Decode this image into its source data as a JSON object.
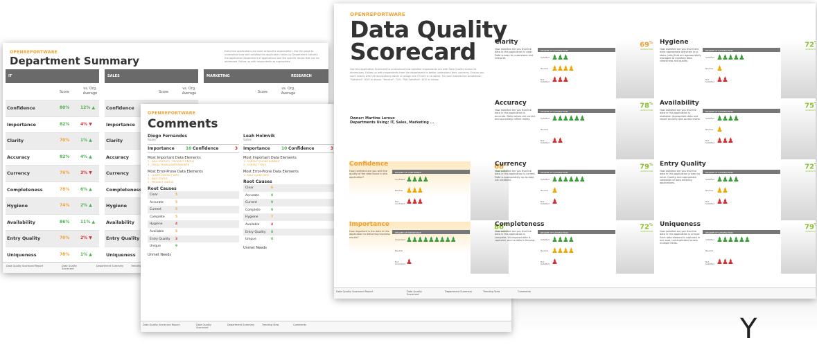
{
  "brand": "OPENREPORTWARE",
  "page1": {
    "title": "Department Summary",
    "description": "Executive applications are used across the organization. Use this page to understand how well satisfied the application varies by Department. Identify the application department of applications and the specific issues that can be addressed. Follow up with respondents as appropriate.",
    "columns": [
      {
        "name": "IT",
        "score_label": "Score",
        "vs_label": "vs. Org. Average",
        "rows": [
          {
            "label": "Confidence",
            "score": "80%",
            "score_color": "green",
            "delta": "12%",
            "dir": "up"
          },
          {
            "label": "Importance",
            "score": "82%",
            "score_color": "green",
            "delta": "4%",
            "dir": "down"
          },
          {
            "label": "Clarity",
            "score": "70%",
            "score_color": "orange",
            "delta": "1%",
            "dir": "up"
          },
          {
            "label": "Accuracy",
            "score": "82%",
            "score_color": "green",
            "delta": "4%",
            "dir": "up"
          },
          {
            "label": "Currency",
            "score": "76%",
            "score_color": "orange",
            "delta": "3%",
            "dir": "down"
          },
          {
            "label": "Completeness",
            "score": "78%",
            "score_color": "orange",
            "delta": "6%",
            "dir": "up"
          },
          {
            "label": "Hygiene",
            "score": "74%",
            "score_color": "orange",
            "delta": "2%",
            "dir": "up"
          },
          {
            "label": "Availability",
            "score": "86%",
            "score_color": "green",
            "delta": "11%",
            "dir": "up"
          },
          {
            "label": "Entry Quality",
            "score": "70%",
            "score_color": "orange",
            "delta": "2%",
            "dir": "down"
          },
          {
            "label": "Uniqueness",
            "score": "78%",
            "score_color": "orange",
            "delta": "1%",
            "dir": "up"
          }
        ]
      },
      {
        "name": "SALES",
        "score_label": "Score",
        "vs_label": "vs. Org. Average",
        "rows": [
          {
            "label": "Confidence"
          },
          {
            "label": "Importance"
          },
          {
            "label": "Clarity"
          },
          {
            "label": "Accuracy"
          },
          {
            "label": "Currency"
          },
          {
            "label": "Completeness"
          },
          {
            "label": "Hygiene"
          },
          {
            "label": "Availability"
          },
          {
            "label": "Entry Quality"
          },
          {
            "label": "Uniqueness"
          }
        ]
      },
      {
        "name": "MARKETING",
        "score_label": "Score",
        "vs_label": "vs. Org. Average",
        "rows": []
      },
      {
        "name": "RESEARCH",
        "rows": []
      }
    ],
    "footer_tabs": [
      "Data Quality Scorecard Report",
      "Data Quality Scorecard",
      "Department Summary",
      "Trending View"
    ]
  },
  "page2": {
    "title": "Comments",
    "people": [
      {
        "name": "Diego Fernandes",
        "dept": "Sales",
        "importance_label": "Importance",
        "importance": "10",
        "confidence_label": "Confidence",
        "confidence": "3",
        "important_heading": "Most Important Data Elements",
        "important_items": [
          "1 - SALE STATUS  2 - PRODUCT STATUS",
          "3 - FISCAL YEAR/QUARTER/MONTH"
        ],
        "error_heading": "Most Error-Prone Data Elements",
        "error_items": [
          "1 - CLIENT CONTACT INFO",
          "2 - SALE STATUS",
          "3 - PRODUCT STATUS"
        ],
        "root_heading": "Root Causes",
        "root_causes": [
          {
            "name": "Clear",
            "value": "5"
          },
          {
            "name": "Accurate",
            "value": "5"
          },
          {
            "name": "Current",
            "value": "5"
          },
          {
            "name": "Complete",
            "value": "5"
          },
          {
            "name": "Hygiene",
            "value": "4"
          },
          {
            "name": "Available",
            "value": "5"
          },
          {
            "name": "Entry Quality",
            "value": "3"
          },
          {
            "name": "Unique",
            "value": "9"
          }
        ],
        "unmet_heading": "Unmet Needs"
      },
      {
        "name": "Leah Holmvik",
        "dept": "Sales",
        "importance_label": "Importance",
        "importance": "10",
        "confidence_label": "Confidence",
        "confidence": "3",
        "important_heading": "Most Important Data Elements",
        "important_items": [
          "1 - CONTACT PHONE NUMBER",
          "2 - CONTACT TITLE"
        ],
        "error_heading": "Most Error-Prone Data Elements",
        "error_items": [
          "1 - SALE CLOSE DATE"
        ],
        "root_heading": "Root Causes",
        "root_causes": [
          {
            "name": "Clear",
            "value": "6"
          },
          {
            "name": "Accurate",
            "value": "8"
          },
          {
            "name": "Current",
            "value": "9"
          },
          {
            "name": "Complete",
            "value": "9"
          },
          {
            "name": "Hygiene",
            "value": "7"
          },
          {
            "name": "Available",
            "value": "4"
          },
          {
            "name": "Entry Quality",
            "value": "8"
          },
          {
            "name": "Unique",
            "value": "8"
          }
        ],
        "unmet_heading": "Unmet Needs"
      }
    ],
    "footer_tabs": [
      "Data Quality Scorecard Report",
      "Data Quality Scorecard",
      "Department Summary",
      "Trending View",
      "Comments"
    ]
  },
  "page3": {
    "title_line1": "Data Quality",
    "title_line2": "Scorecard",
    "intro": "Use this Application Scorecard to understand how satisfied respondents are with Data Quality across 10 dimensions. Follow up with respondents from the department to better understand their concerns. Ensure you work closely with the applications owner or assign one if there is no owner. For each satisfaction breakdown: \"Satisfied\": 8/10 or above. \"Neutral\": 7/10. \"Not Satisfied\": 6/10 or below.",
    "owner": "Owner: Martine Leroux",
    "departments": "Departments Using: IT, Sales, Marketing ...",
    "satisfaction_label": "SATISFACTION",
    "cards": [
      {
        "name": "Clarity",
        "pct": "69",
        "question": "How satisfied are you that the data in this application is clear. Data is easy to understand and interpret.",
        "header": "DEGREE OF SATISFACTION",
        "rows": [
          {
            "label": "Satisfied",
            "icons": "♟♟♟",
            "color": "#3a9d3a"
          },
          {
            "label": "Neutral",
            "icons": "♟♟♟♟",
            "color": "#f0a800"
          },
          {
            "label": "Not Satisfied",
            "icons": "♟♟♟",
            "color": "#d32f2f"
          }
        ],
        "highlight": false
      },
      {
        "name": "Hygiene",
        "pct": "72",
        "question": "How satisfied are you that there exist appropriate activities (e.g. tasks, jobs) that are appropriately managed to maintain data cleanliness and quality.",
        "header": "DEGREE OF SATISFACTION",
        "rows": [
          {
            "label": "Satisfied",
            "icons": "♟♟♟♟♟",
            "color": "#3a9d3a"
          },
          {
            "label": "Neutral",
            "icons": "♟",
            "color": "#f0a800"
          },
          {
            "label": "Not Satisfied",
            "icons": "♟♟",
            "color": "#d32f2f"
          }
        ],
        "highlight": false
      },
      {
        "name": "Accuracy",
        "pct": "78",
        "question": "How satisfied are you that the data in this application is accurate. Data values are correct and accurately reflect reality.",
        "header": "DEGREE OF SATISFACTION",
        "rows": [
          {
            "label": "Satisfied",
            "icons": "♟♟♟♟♟♟",
            "color": "#3a9d3a"
          },
          {
            "label": "Neutral",
            "icons": "",
            "color": "#f0a800"
          },
          {
            "label": "Not Satisfied",
            "icons": "♟♟",
            "color": "#d32f2f"
          }
        ],
        "highlight": false
      },
      {
        "name": "Availability",
        "pct": "75",
        "question": "How satisfied are you that the data in this application is available. Appropriate data and report security and access levels.",
        "header": "DEGREE OF SATISFACTION",
        "rows": [
          {
            "label": "Satisfied",
            "icons": "♟♟♟♟",
            "color": "#3a9d3a"
          },
          {
            "label": "Neutral",
            "icons": "♟",
            "color": "#f0a800"
          },
          {
            "label": "Not Satisfied",
            "icons": "♟♟♟",
            "color": "#d32f2f"
          }
        ],
        "highlight": false
      },
      {
        "name": "Confidence",
        "pct": "68",
        "question": "How confident are you with the quality of the data found in this application?",
        "header": "DEGREE OF CONFIDENCE",
        "rows": [
          {
            "label": "Confident",
            "icons": "♟♟♟♟",
            "color": "#3a9d3a"
          },
          {
            "label": "Neutral",
            "icons": "♟♟♟",
            "color": "#f0a800"
          },
          {
            "label": "Not Confident",
            "icons": "♟♟♟",
            "color": "#d32f2f"
          }
        ],
        "highlight": true
      },
      {
        "name": "Currency",
        "pct": "79",
        "question": "How satisfied are you that the data in this application is current. Data is appropriately up-to-date, not outdated.",
        "header": "DEGREE OF SATISFACTION",
        "rows": [
          {
            "label": "Satisfied",
            "icons": "♟♟♟♟♟♟",
            "color": "#3a9d3a"
          },
          {
            "label": "Neutral",
            "icons": "♟",
            "color": "#f0a800"
          },
          {
            "label": "Not Satisfied",
            "icons": "♟",
            "color": "#d32f2f"
          }
        ],
        "highlight": false
      },
      {
        "name": "Entry Quality",
        "pct": "72",
        "question": "How satisfied are you that the data in this application is easy to enter. Quality and appropriate validation of data entering applications.",
        "header": "DEGREE OF SATISFACTION",
        "rows": [
          {
            "label": "Satisfied",
            "icons": "♟♟♟♟",
            "color": "#3a9d3a"
          },
          {
            "label": "Neutral",
            "icons": "♟♟",
            "color": "#f0a800"
          },
          {
            "label": "Not Satisfied",
            "icons": "♟♟",
            "color": "#d32f2f"
          }
        ],
        "highlight": false
      },
      {
        "name": "Importance",
        "pct": "86",
        "question": "How important is the data in this application to delivering business results?",
        "header": "DEGREE OF IMPORTANCE",
        "rows": [
          {
            "label": "Important",
            "icons": "♟♟♟♟♟♟♟♟♟",
            "color": "#3a9d3a"
          },
          {
            "label": "Neutral",
            "icons": "",
            "color": "#f0a800"
          },
          {
            "label": "Not Important",
            "icons": "♟",
            "color": "#d32f2f"
          }
        ],
        "highlight": true
      },
      {
        "name": "Completeness",
        "pct": "72",
        "question": "How satisfied are you that the data in this application is complete. All required data is captured, and no data is missing.",
        "header": "DEGREE OF SATISFACTION",
        "rows": [
          {
            "label": "Satisfied",
            "icons": "♟♟♟♟",
            "color": "#3a9d3a"
          },
          {
            "label": "Neutral",
            "icons": "♟♟♟♟",
            "color": "#f0a800"
          },
          {
            "label": "Not Satisfied",
            "icons": "♟",
            "color": "#d32f2f"
          }
        ],
        "highlight": false
      },
      {
        "name": "Uniqueness",
        "pct": "79",
        "question": "How satisfied are you that the data in this application is unique. Each data element is captured in one spot, not duplicated across multiple fields.",
        "header": "DEGREE OF SATISFACTION",
        "rows": [
          {
            "label": "Satisfied",
            "icons": "♟♟♟♟♟♟",
            "color": "#3a9d3a"
          },
          {
            "label": "Neutral",
            "icons": "",
            "color": "#f0a800"
          },
          {
            "label": "Not Satisfied",
            "icons": "♟♟♟",
            "color": "#d32f2f"
          }
        ],
        "highlight": false
      }
    ],
    "footer_tabs": [
      "Data Quality Scorecard Report",
      "Data Quality Scorecard",
      "Department Summary",
      "Trending View",
      "Comments"
    ]
  },
  "corner_glyph": "Y"
}
